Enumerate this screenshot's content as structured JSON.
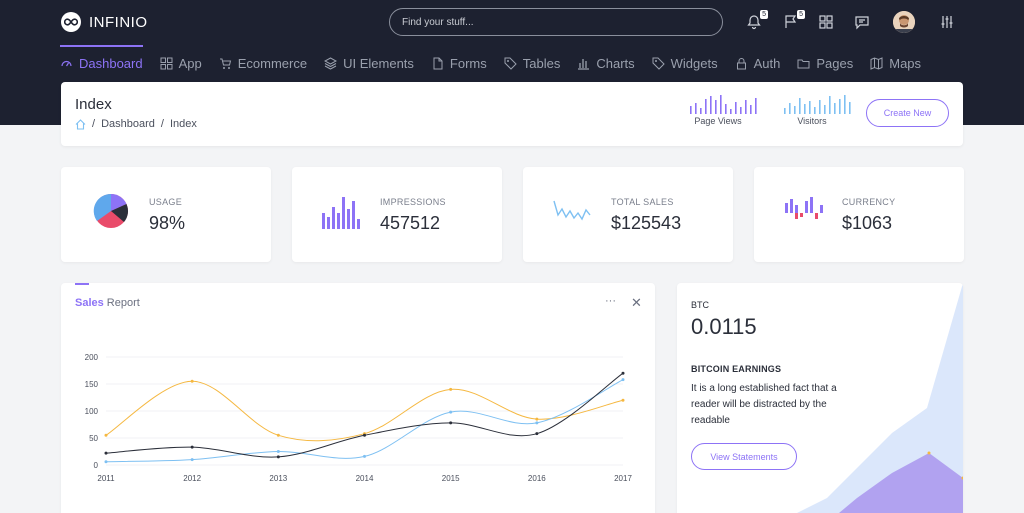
{
  "brand": {
    "name": "INFINIO"
  },
  "search": {
    "placeholder": "Find your stuff..."
  },
  "header": {
    "notifications_count": "5",
    "flags_count": "5"
  },
  "nav": [
    {
      "label": "Dashboard",
      "icon": "dashboard-icon"
    },
    {
      "label": "App",
      "icon": "grid-icon"
    },
    {
      "label": "Ecommerce",
      "icon": "cart-icon"
    },
    {
      "label": "UI Elements",
      "icon": "layers-icon"
    },
    {
      "label": "Forms",
      "icon": "file-icon"
    },
    {
      "label": "Tables",
      "icon": "tag-icon"
    },
    {
      "label": "Charts",
      "icon": "bar-chart-icon"
    },
    {
      "label": "Widgets",
      "icon": "tag-icon"
    },
    {
      "label": "Auth",
      "icon": "lock-icon"
    },
    {
      "label": "Pages",
      "icon": "folder-icon"
    },
    {
      "label": "Maps",
      "icon": "map-icon"
    }
  ],
  "page": {
    "title": "Index",
    "breadcrumb": [
      "Dashboard",
      "Index"
    ],
    "page_views_label": "Page Views",
    "visitors_label": "Visitors",
    "create_button": "Create New"
  },
  "stats": [
    {
      "label": "USAGE",
      "value": "98%"
    },
    {
      "label": "IMPRESSIONS",
      "value": "457512"
    },
    {
      "label": "TOTAL SALES",
      "value": "$125543"
    },
    {
      "label": "CURRENCY",
      "value": "$1063"
    }
  ],
  "sales_report": {
    "title_bold": "Sales",
    "title_rest": " Report",
    "more": "···",
    "close": "✕"
  },
  "btc": {
    "label": "BTC",
    "value": "0.0115",
    "earnings_title": "BITCOIN EARNINGS",
    "description": "It is a long established fact that a reader will be distracted by the readable",
    "button": "View Statements"
  },
  "colors": {
    "accent": "#8d73f6",
    "header_bg": "#1d2130",
    "orange": "#f5b841",
    "blue": "#7ec0f2",
    "dark": "#2b2f3a"
  },
  "chart_data": {
    "type": "line",
    "title": "",
    "x": [
      "2011",
      "2012",
      "2013",
      "2014",
      "2015",
      "2016",
      "2017"
    ],
    "ylim": [
      0,
      200
    ],
    "yticks": [
      0,
      50,
      100,
      150,
      200
    ],
    "series": [
      {
        "color": "#f5b841",
        "values": [
          55,
          155,
          55,
          58,
          140,
          85,
          120
        ]
      },
      {
        "color": "#7ec0f2",
        "values": [
          6,
          10,
          25,
          16,
          98,
          78,
          158
        ]
      },
      {
        "color": "#2b2f3a",
        "values": [
          22,
          33,
          15,
          55,
          78,
          58,
          170
        ]
      }
    ]
  }
}
